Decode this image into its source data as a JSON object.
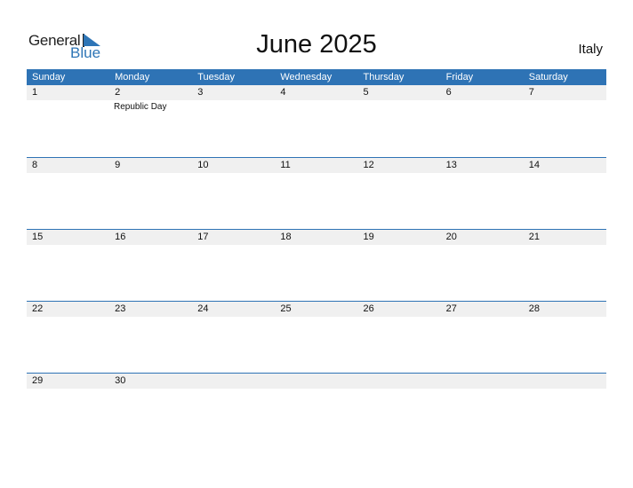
{
  "logo": {
    "word1": "General",
    "word2": "Blue"
  },
  "title": "June 2025",
  "country": "Italy",
  "colors": {
    "accent": "#2e73b5",
    "strip": "#f0f0f0"
  },
  "weekdays": [
    "Sunday",
    "Monday",
    "Tuesday",
    "Wednesday",
    "Thursday",
    "Friday",
    "Saturday"
  ],
  "weeks": [
    [
      "1",
      "2",
      "3",
      "4",
      "5",
      "6",
      "7"
    ],
    [
      "8",
      "9",
      "10",
      "11",
      "12",
      "13",
      "14"
    ],
    [
      "15",
      "16",
      "17",
      "18",
      "19",
      "20",
      "21"
    ],
    [
      "22",
      "23",
      "24",
      "25",
      "26",
      "27",
      "28"
    ],
    [
      "29",
      "30",
      "",
      "",
      "",
      "",
      ""
    ]
  ],
  "events": [
    {
      "date": "2",
      "label": "Republic Day"
    }
  ]
}
